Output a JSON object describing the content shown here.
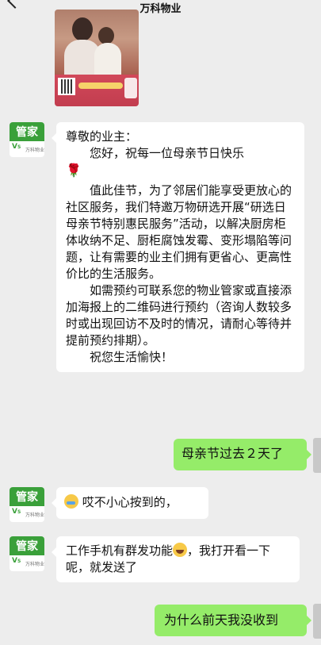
{
  "header": {
    "title": "万科物业"
  },
  "messages": [
    {
      "from": "manager",
      "avatar_label": "管家",
      "avatar_brand": "万科物业",
      "lines": [
        "尊敬的业主：",
        "您好，祝每一位母亲节日快乐",
        "值此佳节，为了邻居们能享受更放心的社区服务，我们特邀万物研选开展“研选日母亲节特别惠民服务”活动，以解决厨房柜体收纳不足、厨柜腐蚀发霉、变形塌陷等问题，让有需要的业主们拥有更省心、更高性价比的生活服务。",
        "如需预约可联系您的物业管家或直接添加海报上的二维码进行预约（咨询人数较多时或出现回访不及时的情况，请耐心等待并提前预约排期）。",
        "祝您生活愉快！"
      ]
    },
    {
      "from": "me",
      "text": "母亲节过去２天了"
    },
    {
      "from": "manager",
      "avatar_label": "管家",
      "avatar_brand": "万科物业",
      "text": "哎不小心按到的，"
    },
    {
      "from": "manager",
      "avatar_label": "管家",
      "avatar_brand": "万科物业",
      "text_a": "工作手机有群发功能",
      "text_b": "，我打开看一下呢，就发送了"
    },
    {
      "from": "me",
      "text": "为什么前天我没收到"
    }
  ],
  "icons": {
    "back": "back-arrow-icon",
    "rose": "rose-emoji-icon",
    "cry": "cry-emoji-icon",
    "laugh": "laugh-emoji-icon",
    "logo": "vanke-logo-icon"
  },
  "colors": {
    "background": "#ededed",
    "incoming": "#ffffff",
    "outgoing": "#95ec69",
    "avatar_green": "#3aa03a"
  }
}
